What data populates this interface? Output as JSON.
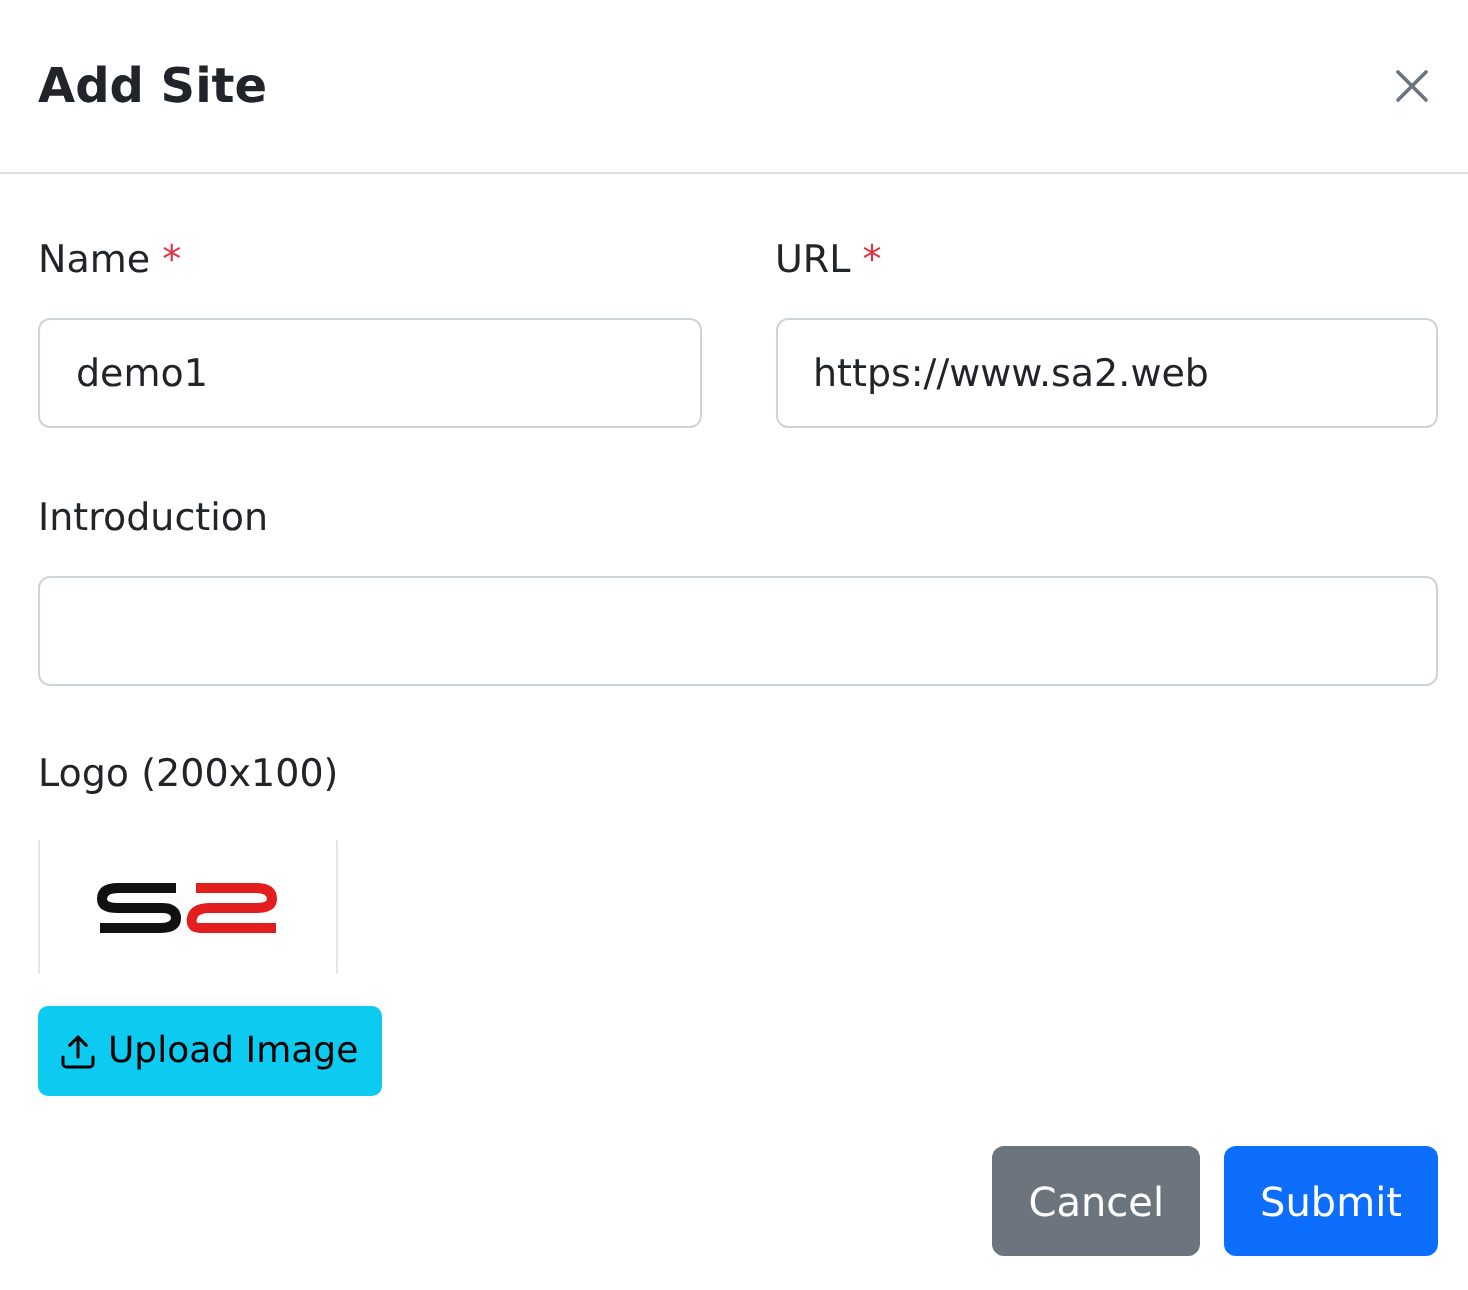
{
  "dialog": {
    "title": "Add Site"
  },
  "field_rows": [
    [
      {
        "label": "Name",
        "required_mark": "*",
        "value": "demo1"
      },
      {
        "label": "URL",
        "required_mark": "*",
        "value": "https://www.sa2.web"
      }
    ],
    [
      {
        "label": "Introduction"
      }
    ]
  ],
  "logo": {
    "label": "Logo (200x100)",
    "upload_button": "Upload Image"
  },
  "buttons": [
    {
      "label": "Cancel",
      "kind": "secondary"
    },
    {
      "label": "Submit",
      "kind": "primary"
    }
  ]
}
